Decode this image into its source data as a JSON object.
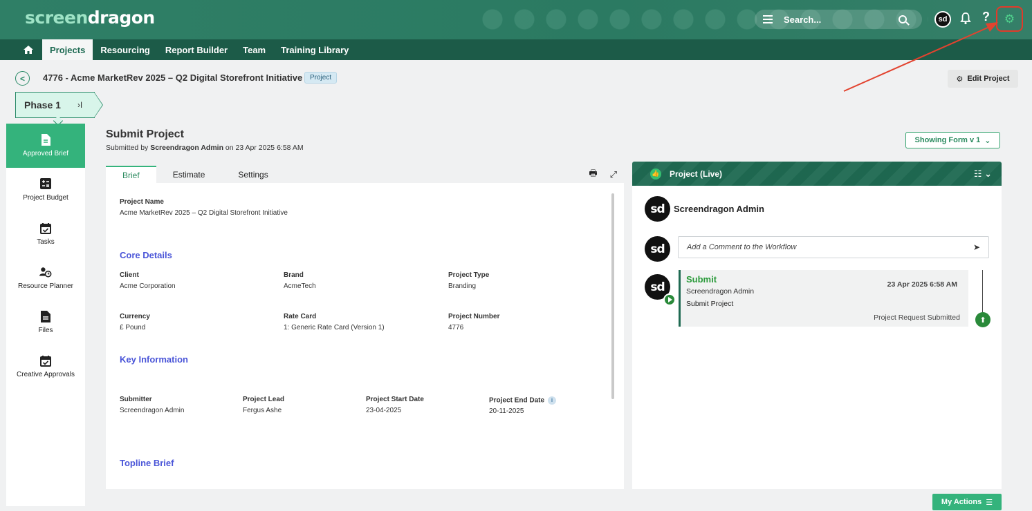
{
  "header": {
    "logo_a": "screen",
    "logo_b": "dragon",
    "search_placeholder": "Search...",
    "avatar_initials": "sd",
    "help_glyph": "?",
    "accent": "#2f7f66"
  },
  "nav": {
    "tabs": [
      {
        "label": "Projects",
        "active": true
      },
      {
        "label": "Resourcing"
      },
      {
        "label": "Report Builder"
      },
      {
        "label": "Team"
      },
      {
        "label": "Training Library"
      }
    ]
  },
  "project": {
    "title": "4776 - Acme MarketRev 2025 – Q2 Digital Storefront Initiative",
    "badge": "Project",
    "edit_label": "Edit Project"
  },
  "phase": {
    "label": "Phase 1",
    "skip": "›I"
  },
  "sidebar": {
    "items": [
      {
        "label": "Approved Brief",
        "icon": "brief-icon",
        "active": true
      },
      {
        "label": "Project Budget",
        "icon": "calculator-icon"
      },
      {
        "label": "Tasks",
        "icon": "calendar-check-icon"
      },
      {
        "label": "Resource Planner",
        "icon": "user-clock-icon"
      },
      {
        "label": "Files",
        "icon": "file-icon"
      },
      {
        "label": "Creative Approvals",
        "icon": "calendar-check-icon"
      }
    ]
  },
  "submit": {
    "title": "Submit Project",
    "by_prefix": "Submitted by ",
    "by_user": "Screendragon Admin",
    "by_suffix": " on 23 Apr 2025 6:58 AM",
    "showing_form": "Showing Form v 1"
  },
  "form": {
    "tabs": [
      "Brief",
      "Estimate",
      "Settings"
    ],
    "project_name_label": "Project Name",
    "project_name_value": "Acme MarketRev 2025 – Q2 Digital Storefront Initiative",
    "core_details": "Core Details",
    "client_label": "Client",
    "client_value": "Acme Corporation",
    "brand_label": "Brand",
    "brand_value": "AcmeTech",
    "ptype_label": "Project Type",
    "ptype_value": "Branding",
    "currency_label": "Currency",
    "currency_value": "£ Pound",
    "ratecard_label": "Rate Card",
    "ratecard_value": "1: Generic Rate Card (Version 1)",
    "pnum_label": "Project Number",
    "pnum_value": "4776",
    "key_info": "Key Information",
    "submitter_label": "Submitter",
    "submitter_value": "Screendragon Admin",
    "lead_label": "Project Lead",
    "lead_value": "Fergus Ashe",
    "start_label": "Project Start Date",
    "start_value": "23-04-2025",
    "end_label": "Project End Date",
    "end_value": "20-11-2025",
    "topline": "Topline Brief"
  },
  "workflow": {
    "header": "Project (Live)",
    "user": "Screendragon Admin",
    "comment_placeholder": "Add a Comment to the Workflow",
    "card_title": "Submit",
    "card_user": "Screendragon Admin",
    "card_step": "Submit Project",
    "card_date": "23 Apr 2025 6:58 AM",
    "card_status": "Project Request Submitted"
  },
  "my_actions": "My Actions"
}
